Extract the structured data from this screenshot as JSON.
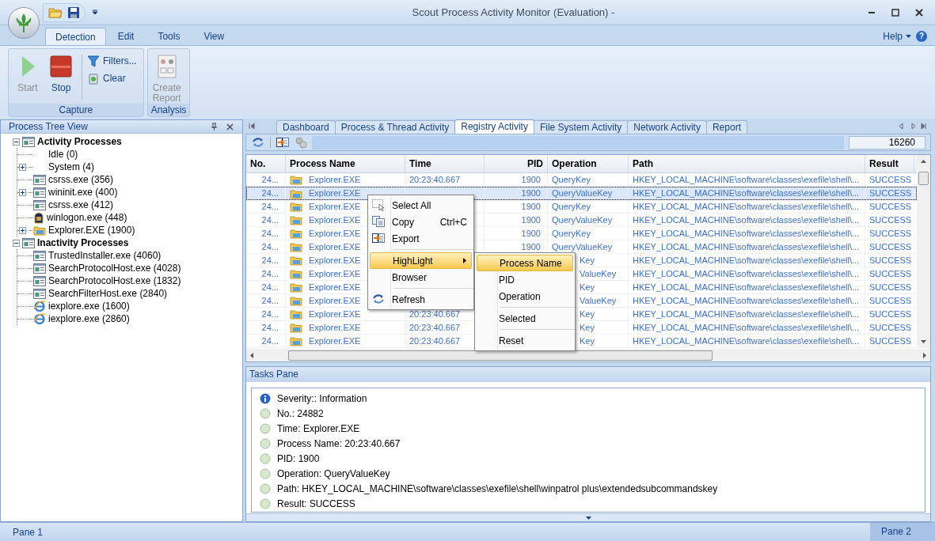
{
  "window": {
    "title": "Scout Process Activity Monitor (Evaluation) -"
  },
  "ribbon": {
    "tabs": [
      {
        "label": "Detection",
        "selected": true
      },
      {
        "label": "Edit",
        "selected": false
      },
      {
        "label": "Tools",
        "selected": false
      },
      {
        "label": "View",
        "selected": false
      }
    ],
    "help": {
      "label": "Help",
      "glyph": "?"
    },
    "groups": [
      {
        "label": "Capture",
        "buttons": [
          {
            "label": "Start",
            "kind": "start",
            "disabled": true
          },
          {
            "label": "Stop",
            "kind": "stop",
            "disabled": false
          }
        ],
        "small_buttons": [
          {
            "label": "Filters...",
            "kind": "filter"
          },
          {
            "label": "Clear",
            "kind": "clear"
          }
        ]
      },
      {
        "label": "Analysis",
        "buttons": [
          {
            "label": "Create Report",
            "kind": "report",
            "disabled": true
          }
        ]
      }
    ]
  },
  "tree_panel": {
    "title": "Process Tree View",
    "items": [
      {
        "label": "Activity Processes",
        "kind": "window",
        "expanded": true,
        "children": [
          {
            "label": "Idle (0)",
            "kind": "plain"
          },
          {
            "label": "System (4)",
            "kind": "plain",
            "expanded": false
          },
          {
            "label": "csrss.exe (356)",
            "kind": "window"
          },
          {
            "label": "wininit.exe (400)",
            "kind": "window",
            "expanded": false
          },
          {
            "label": "csrss.exe (412)",
            "kind": "window"
          },
          {
            "label": "winlogon.exe (448)",
            "kind": "emblem"
          },
          {
            "label": "Explorer.EXE (1900)",
            "kind": "folder",
            "expanded": false
          }
        ]
      },
      {
        "label": "Inactivity Processes",
        "kind": "window",
        "expanded": true,
        "children": [
          {
            "label": "TrustedInstaller.exe (4060)",
            "kind": "window"
          },
          {
            "label": "SearchProtocolHost.exe (4028)",
            "kind": "window"
          },
          {
            "label": "SearchProtocolHost.exe (1832)",
            "kind": "window"
          },
          {
            "label": "SearchFilterHost.exe (2840)",
            "kind": "window"
          },
          {
            "label": "iexplore.exe (1600)",
            "kind": "globe"
          },
          {
            "label": "iexplore.exe (2860)",
            "kind": "globe"
          }
        ]
      }
    ]
  },
  "tabs": [
    {
      "label": "Dashboard",
      "selected": false
    },
    {
      "label": "Process & Thread Activity",
      "selected": false
    },
    {
      "label": "Registry Activity",
      "selected": true
    },
    {
      "label": "File System Activity",
      "selected": false
    },
    {
      "label": "Network Activity",
      "selected": false
    },
    {
      "label": "Report",
      "selected": false
    }
  ],
  "toolbar": {
    "counter": "16260"
  },
  "table": {
    "columns": [
      "No.",
      "Process Name",
      "Time",
      "PID",
      "Operation",
      "Path",
      "Result"
    ],
    "rows": [
      {
        "no": "24...",
        "process": "Explorer.EXE",
        "time": "20:23:40.667",
        "pid": "1900",
        "operation": "QueryKey",
        "path": "HKEY_LOCAL_MACHINE\\software\\classes\\exefile\\shell\\...",
        "result": "SUCCESS",
        "selected": false
      },
      {
        "no": "24...",
        "process": "Explorer.EXE",
        "pid": "1900",
        "operation": "QueryValueKey",
        "path": "HKEY_LOCAL_MACHINE\\software\\classes\\exefile\\shell\\...",
        "result": "SUCCESS",
        "selected": true
      },
      {
        "no": "24...",
        "process": "Explorer.EXE",
        "pid": "1900",
        "operation": "QueryKey",
        "path": "HKEY_LOCAL_MACHINE\\software\\classes\\exefile\\shell\\...",
        "result": "SUCCESS",
        "selected": false
      },
      {
        "no": "24...",
        "process": "Explorer.EXE",
        "pid": "1900",
        "operation": "QueryValueKey",
        "path": "HKEY_LOCAL_MACHINE\\software\\classes\\exefile\\shell\\...",
        "result": "SUCCESS",
        "selected": false
      },
      {
        "no": "24...",
        "process": "Explorer.EXE",
        "pid": "1900",
        "operation": "QueryKey",
        "path": "HKEY_LOCAL_MACHINE\\software\\classes\\exefile\\shell\\...",
        "result": "SUCCESS",
        "selected": false
      },
      {
        "no": "24...",
        "process": "Explorer.EXE",
        "pid": "1900",
        "operation": "QueryValueKey",
        "path": "HKEY_LOCAL_MACHINE\\software\\classes\\exefile\\shell\\...",
        "result": "SUCCESS",
        "selected": false
      },
      {
        "no": "24...",
        "process": "Explorer.EXE",
        "operation": "Key",
        "operation_covered": true,
        "path": "HKEY_LOCAL_MACHINE\\software\\classes\\exefile\\shell\\...",
        "result": "SUCCESS",
        "selected": false
      },
      {
        "no": "24...",
        "process": "Explorer.EXE",
        "operation": "ValueKey",
        "operation_covered": true,
        "path": "HKEY_LOCAL_MACHINE\\software\\classes\\exefile\\shell\\...",
        "result": "SUCCESS",
        "selected": false
      },
      {
        "no": "24...",
        "process": "Explorer.EXE",
        "operation": "Key",
        "operation_covered": true,
        "path": "HKEY_LOCAL_MACHINE\\software\\classes\\exefile\\shell\\...",
        "result": "SUCCESS",
        "selected": false
      },
      {
        "no": "24...",
        "process": "Explorer.EXE",
        "operation": "ValueKey",
        "operation_covered": true,
        "path": "HKEY_LOCAL_MACHINE\\software\\classes\\exefile\\shell\\...",
        "result": "SUCCESS",
        "selected": false
      },
      {
        "no": "24...",
        "process": "Explorer.EXE",
        "time": "20:23:40.667",
        "operation": "Key",
        "operation_covered": true,
        "path": "HKEY_LOCAL_MACHINE\\software\\classes\\exefile\\shell\\...",
        "result": "SUCCESS",
        "selected": false
      },
      {
        "no": "24...",
        "process": "Explorer.EXE",
        "time": "20:23:40.667",
        "operation": "Key",
        "operation_covered": true,
        "path": "HKEY_LOCAL_MACHINE\\software\\classes\\exefile\\shell\\...",
        "result": "SUCCESS",
        "selected": false
      },
      {
        "no": "24...",
        "process": "Explorer.EXE",
        "time": "20:23:40.667",
        "operation": "Key",
        "operation_covered": true,
        "path": "HKEY_LOCAL_MACHINE\\software\\classes\\exefile\\shell\\...",
        "result": "SUCCESS",
        "selected": false
      }
    ]
  },
  "context_menu": {
    "items": [
      {
        "kind": "select",
        "label": "Select All",
        "selected": false
      },
      {
        "kind": "copy",
        "label": "Copy",
        "shortcut": "Ctrl+C",
        "selected": false
      },
      {
        "kind": "export",
        "label": "Export",
        "selected": false
      },
      {
        "kind": "separator"
      },
      {
        "kind": "plain",
        "label": "HighLight",
        "has_submenu": true,
        "selected": true
      },
      {
        "kind": "plain",
        "label": "Browser",
        "selected": false
      },
      {
        "kind": "separator"
      },
      {
        "kind": "refresh",
        "label": "Refresh",
        "selected": false
      }
    ],
    "submenu": [
      {
        "kind": "plain",
        "label": "Process Name",
        "selected": true
      },
      {
        "kind": "plain",
        "label": "PID",
        "selected": false
      },
      {
        "kind": "plain",
        "label": "Operation",
        "selected": false
      },
      {
        "kind": "separator"
      },
      {
        "kind": "plain",
        "label": "Selected",
        "selected": false
      },
      {
        "kind": "separator"
      },
      {
        "kind": "plain",
        "label": "Reset",
        "selected": false
      }
    ]
  },
  "tasks_pane": {
    "title": "Tasks Pane",
    "items": [
      {
        "kind": "info",
        "text": "Severity:: Information"
      },
      {
        "kind": "bullet",
        "text": "No.: 24882"
      },
      {
        "kind": "bullet",
        "text": "Time: Explorer.EXE"
      },
      {
        "kind": "bullet",
        "text": "Process Name: 20:23:40.667"
      },
      {
        "kind": "bullet",
        "text": "PID: 1900"
      },
      {
        "kind": "bullet",
        "text": "Operation: QueryValueKey"
      },
      {
        "kind": "bullet",
        "text": "Path: HKEY_LOCAL_MACHINE\\software\\classes\\exefile\\shell\\winpatrol plus\\extendedsubcommandskey"
      },
      {
        "kind": "bullet",
        "text": "Result: SUCCESS"
      }
    ]
  },
  "status_bar": {
    "left": "Pane 1",
    "right": "Pane 2"
  }
}
